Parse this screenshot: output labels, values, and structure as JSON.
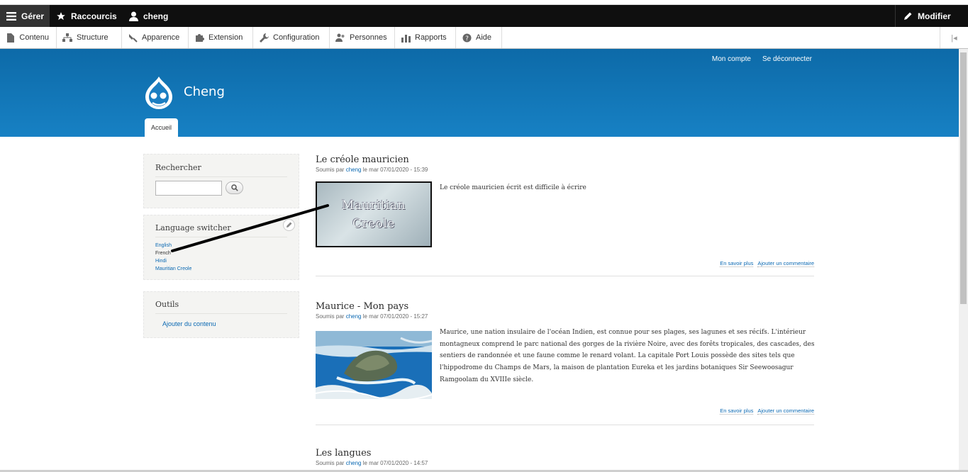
{
  "toolbar": {
    "manage": "Gérer",
    "shortcuts": "Raccourcis",
    "user": "cheng",
    "edit": "Modifier"
  },
  "tray": {
    "items": [
      {
        "label": "Contenu",
        "icon": "file-icon"
      },
      {
        "label": "Structure",
        "icon": "sitemap-icon"
      },
      {
        "label": "Apparence",
        "icon": "brush-icon"
      },
      {
        "label": "Extension",
        "icon": "puzzle-icon"
      },
      {
        "label": "Configuration",
        "icon": "wrench-icon"
      },
      {
        "label": "Personnes",
        "icon": "people-icon"
      },
      {
        "label": "Rapports",
        "icon": "bar-chart-icon"
      },
      {
        "label": "Aide",
        "icon": "help-icon"
      }
    ]
  },
  "header": {
    "my_account": "Mon compte",
    "logout": "Se déconnecter",
    "site_name": "Cheng",
    "home_tab": "Accueil"
  },
  "sidebar": {
    "search_title": "Rechercher",
    "language_title": "Language switcher",
    "languages": [
      "English",
      "French",
      "Hindi",
      "Mauritian Creole"
    ],
    "tools_title": "Outils",
    "add_content": "Ajouter du contenu"
  },
  "nodes": [
    {
      "title": "Le créole mauricien",
      "submitted_prefix": "Soumis par",
      "author": "cheng",
      "date": "le mar 07/01/2020 - 15:39",
      "image_text_1": "Mauritian",
      "image_text_2": "Creole",
      "body": "Le créole mauricien écrit est difficile à écrire",
      "read_more": "En savoir plus",
      "add_comment": "Ajouter un commentaire"
    },
    {
      "title": "Maurice - Mon pays",
      "submitted_prefix": "Soumis par",
      "author": "cheng",
      "date": "le mar 07/01/2020 - 15:27",
      "body": "Maurice, une nation insulaire de l'océan Indien, est connue pour ses plages, ses lagunes et ses récifs. L'intérieur montagneux comprend le parc national des gorges de la rivière Noire, avec des forêts tropicales, des cascades, des sentiers de randonnée et une faune comme le renard volant. La capitale Port Louis possède des sites tels que l'hippodrome du Champs de Mars, la maison de plantation Eureka et les jardins botaniques Sir Seewoosagur Ramgoolam du XVIIIe siècle.",
      "read_more": "En savoir plus",
      "add_comment": "Ajouter un commentaire"
    },
    {
      "title": "Les langues",
      "submitted_prefix": "Soumis par",
      "author": "cheng",
      "date": "le mar 07/01/2020 - 14:57"
    }
  ]
}
